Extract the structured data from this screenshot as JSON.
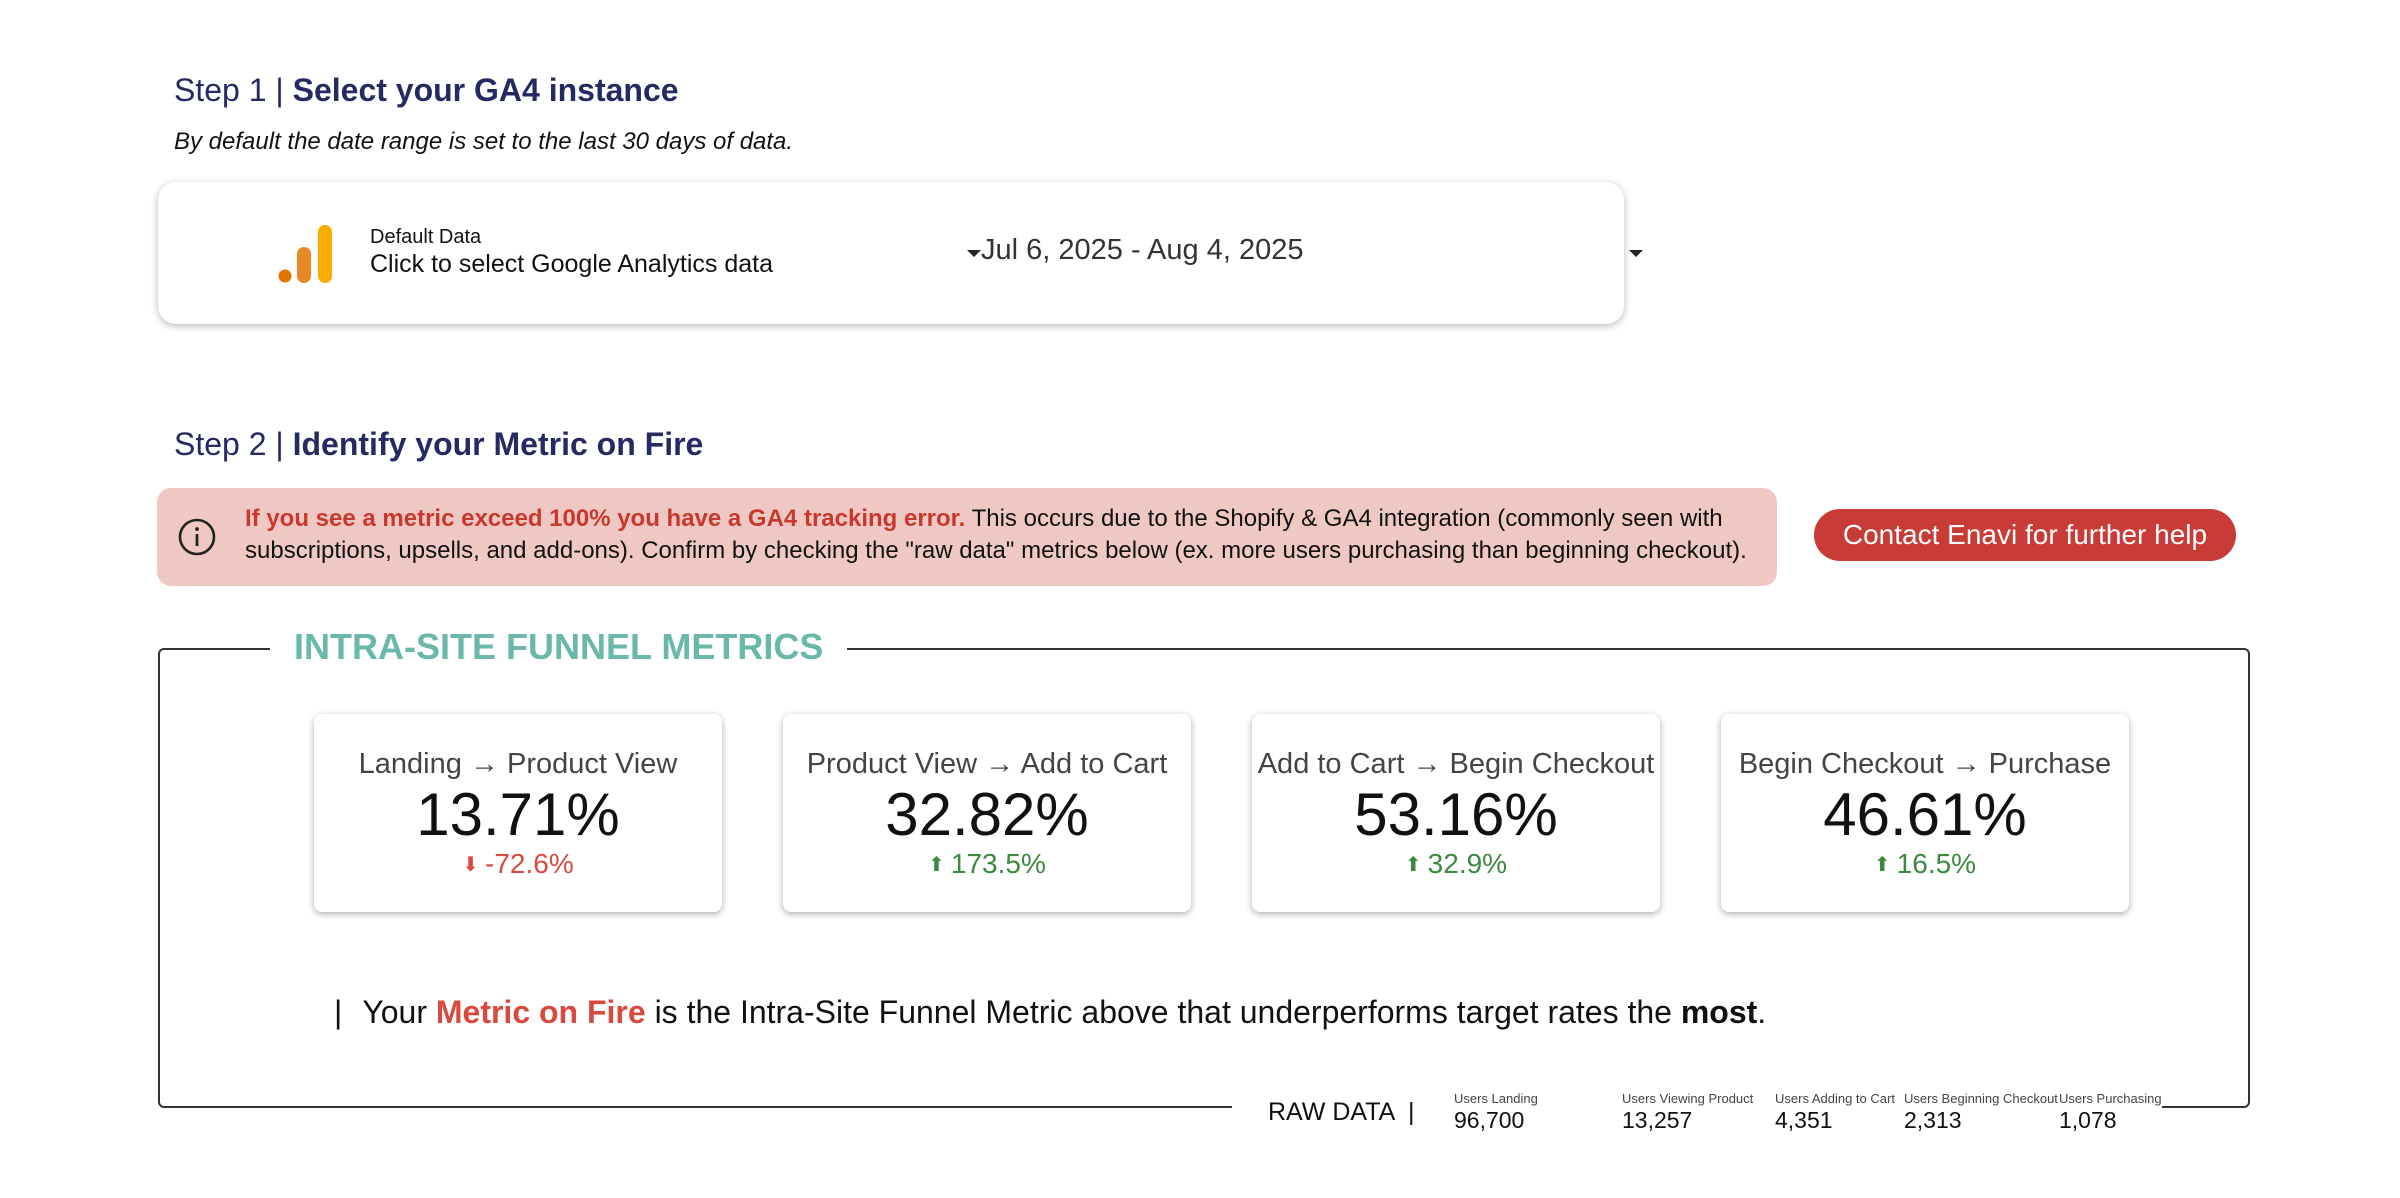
{
  "step1": {
    "prefix": "Step 1 | ",
    "title": "Select your GA4 instance",
    "note": "By default the date range is set to the last 30 days of data."
  },
  "data_source": {
    "label": "Default Data",
    "value": "Click to select Google Analytics data",
    "icon": "google-analytics-logo"
  },
  "date_range": {
    "value": "Jul 6, 2025 - Aug 4, 2025"
  },
  "step2": {
    "prefix": "Step 2 | ",
    "title": "Identify your Metric on Fire"
  },
  "alert": {
    "icon": "info-circle-icon",
    "strong": "If you see a metric exceed 100% you have a GA4 tracking error.",
    "text": " This occurs due to the Shopify & GA4 integration (commonly seen with subscriptions, upsells, and add-ons). Confirm by checking the \"raw data\" metrics below (ex. more users purchasing than beginning checkout)."
  },
  "contact_button": "Contact Enavi for further help",
  "funnel": {
    "title": "INTRA-SITE FUNNEL METRICS",
    "metrics": [
      {
        "label": "Landing → Product View",
        "value": "13.71%",
        "delta": "-72.6%",
        "direction": "down"
      },
      {
        "label": "Product View → Add to Cart",
        "value": "32.82%",
        "delta": "173.5%",
        "direction": "up"
      },
      {
        "label": "Add to Cart → Begin Checkout",
        "value": "53.16%",
        "delta": "32.9%",
        "direction": "up"
      },
      {
        "label": "Begin Checkout → Purchase",
        "value": "46.61%",
        "delta": "16.5%",
        "direction": "up"
      }
    ],
    "fire_line": {
      "pipe": "|",
      "before": "Your ",
      "highlight": "Metric on Fire",
      "middle": " is the Intra-Site Funnel Metric above that underperforms target rates the ",
      "bold": "most",
      "end": "."
    }
  },
  "raw_data": {
    "title": "RAW DATA",
    "separator": "|",
    "stats": [
      {
        "label": "Users Landing",
        "value": "96,700"
      },
      {
        "label": "Users Viewing Product",
        "value": "13,257"
      },
      {
        "label": "Users Adding to Cart",
        "value": "4,351"
      },
      {
        "label": "Users Beginning Checkout",
        "value": "2,313"
      },
      {
        "label": "Users Purchasing",
        "value": "1,078"
      }
    ]
  },
  "colors": {
    "heading": "#262a63",
    "accent_red": "#c93b36",
    "alert_bg": "#f0c8c3",
    "funnel_title": "#6ab8aa",
    "delta_up": "#3b8a3e",
    "delta_down": "#d84a3f"
  }
}
